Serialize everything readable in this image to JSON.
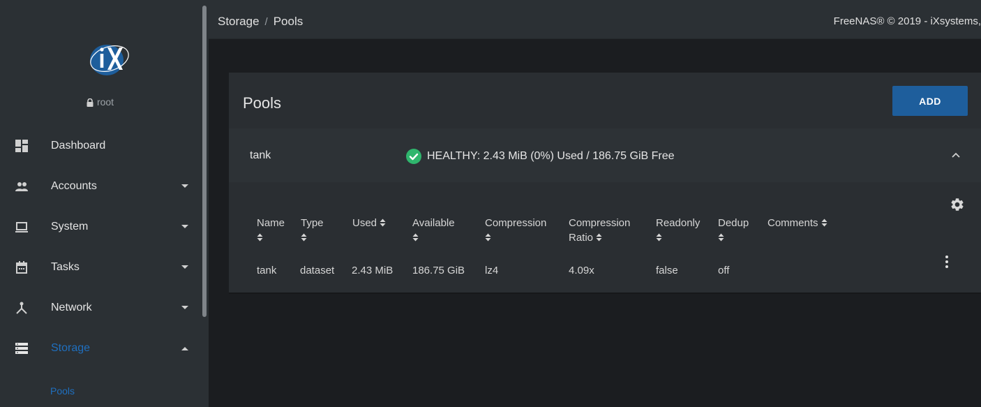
{
  "app": {
    "copyright": "FreeNAS® © 2019 - iXsystems,"
  },
  "breadcrumb": {
    "parent": "Storage",
    "separator": "/",
    "current": "Pools"
  },
  "user": {
    "name": "root",
    "icon": "lock-icon"
  },
  "sidebar": {
    "items": [
      {
        "label": "Dashboard",
        "icon": "dashboard-icon",
        "expandable": false
      },
      {
        "label": "Accounts",
        "icon": "accounts-icon",
        "expandable": true
      },
      {
        "label": "System",
        "icon": "laptop-icon",
        "expandable": true
      },
      {
        "label": "Tasks",
        "icon": "calendar-icon",
        "expandable": true
      },
      {
        "label": "Network",
        "icon": "network-icon",
        "expandable": true
      },
      {
        "label": "Storage",
        "icon": "storage-icon",
        "expandable": true,
        "active": true
      }
    ],
    "subitem": "Pools",
    "active_color": "#1f6fbf"
  },
  "card": {
    "title": "Pools",
    "add_label": "ADD"
  },
  "pool": {
    "name": "tank",
    "status": "HEALTHY: 2.43 MiB (0%) Used / 186.75 GiB Free",
    "status_color": "#2fb66d"
  },
  "table": {
    "headers": [
      {
        "line1": "Name",
        "line2": ""
      },
      {
        "line1": "Type",
        "line2": ""
      },
      {
        "line1": "Used",
        "line2": ""
      },
      {
        "line1": "Available",
        "line2": ""
      },
      {
        "line1": "Compression",
        "line2": ""
      },
      {
        "line1": "Compression",
        "line2": "Ratio"
      },
      {
        "line1": "Readonly",
        "line2": ""
      },
      {
        "line1": "Dedup",
        "line2": ""
      },
      {
        "line1": "Comments",
        "line2": ""
      }
    ],
    "rows": [
      [
        "tank",
        "dataset",
        "2.43 MiB",
        "186.75 GiB",
        "lz4",
        "4.09x",
        "false",
        "off",
        ""
      ]
    ]
  },
  "colors": {
    "accent": "#1e5e9c",
    "sidebar_bg": "#2b3034",
    "content_bg": "#1b1d20"
  }
}
